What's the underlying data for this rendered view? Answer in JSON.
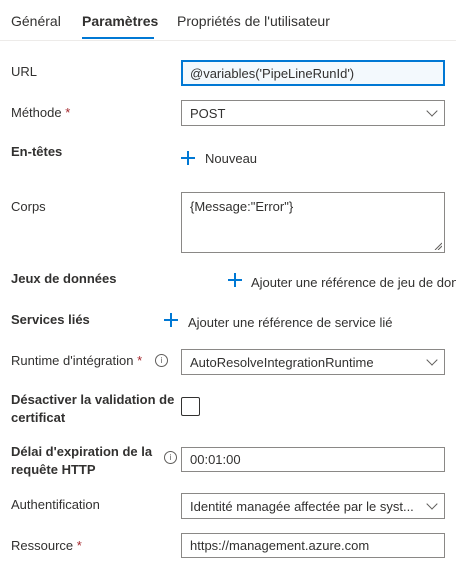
{
  "tabs": [
    {
      "label": "Général"
    },
    {
      "label": "Paramètres"
    },
    {
      "label": "Propriétés de l'utilisateur"
    }
  ],
  "fields": {
    "url": {
      "label": "URL",
      "value": "@variables('PipeLineRunId')"
    },
    "method": {
      "label": "Méthode",
      "required_mark": "*",
      "value": "POST"
    },
    "headers": {
      "label": "En-têtes",
      "add_label": "Nouveau"
    },
    "body": {
      "label": "Corps",
      "value": "{Message:\"Error\"}"
    },
    "datasets": {
      "label": "Jeux de données",
      "add_label": "Ajouter une référence de jeu de don"
    },
    "linked_services": {
      "label": "Services liés",
      "add_label": "Ajouter une référence de service lié"
    },
    "runtime": {
      "label": "Runtime d'intégration",
      "required_mark": "*",
      "info": "i",
      "value": "AutoResolveIntegrationRuntime"
    },
    "cert_validation": {
      "label_line1": "Désactiver la validation de",
      "label_line2": "certificat",
      "checked": false
    },
    "timeout": {
      "label_line1": "Délai d'expiration de la",
      "label_line2": "requête HTTP",
      "info": "i",
      "value": "00:01:00"
    },
    "auth": {
      "label": "Authentification",
      "value": "Identité managée affectée par le syst..."
    },
    "resource": {
      "label": "Ressource",
      "required_mark": "*",
      "value": "https://management.azure.com"
    }
  }
}
